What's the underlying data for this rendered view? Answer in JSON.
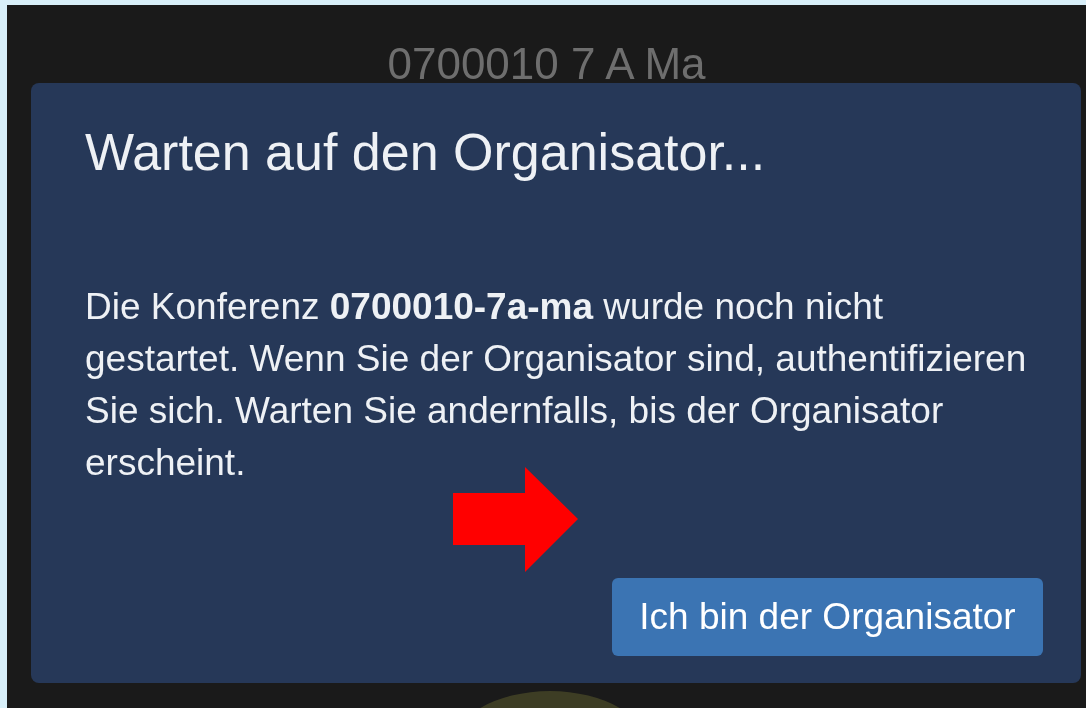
{
  "header": {
    "title": "0700010 7 A Ma"
  },
  "dialog": {
    "title": "Warten auf den Organisator...",
    "message": "Die Konferenz **0700010-7a-ma** wurde noch nicht gestartet. Wenn Sie der Organisator sind, authentifizieren Sie sich. Warten Sie andernfalls, bis der Organisator erscheint.",
    "button": "Ich bin der Organisator"
  }
}
